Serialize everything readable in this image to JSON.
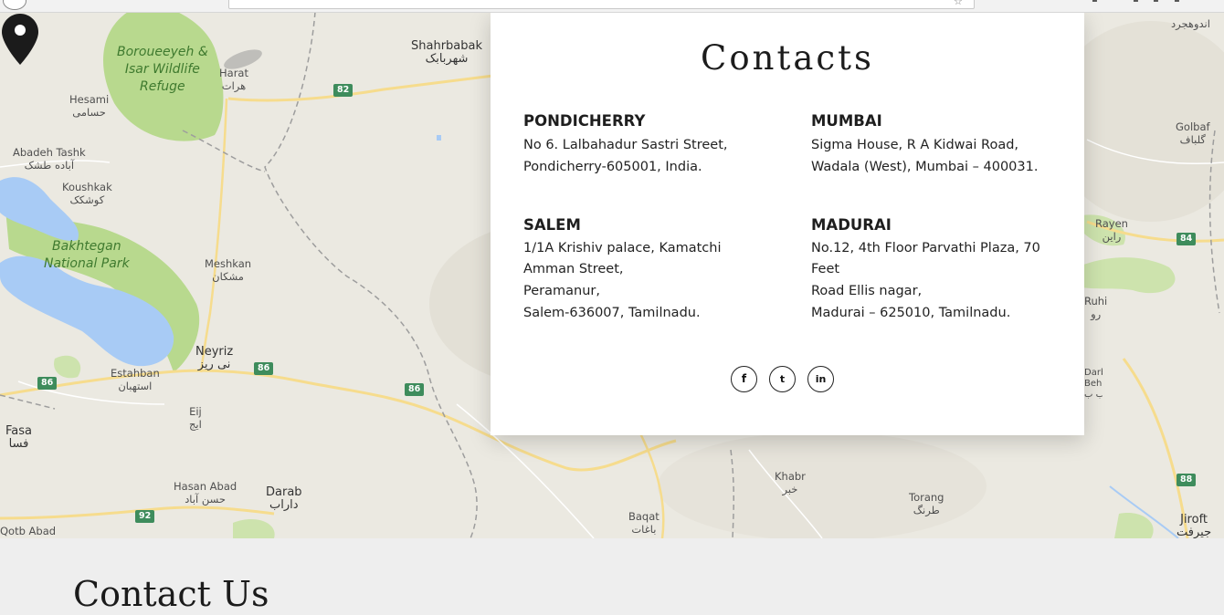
{
  "colors": {
    "map_bg": "#ebe9e1",
    "park": "#b8d98e",
    "water": "#a8cbf5",
    "road": "#f6dc8d",
    "shield": "#3e8c5c",
    "card_bg": "#ffffff",
    "heading": "#1c1c1c"
  },
  "map": {
    "labels": [
      {
        "id": "shahrbabak",
        "text": "Shahrbabak",
        "sub": "شهربابک"
      },
      {
        "id": "harat",
        "text": "Harat",
        "sub": "هرات"
      },
      {
        "id": "hesami",
        "text": "Hesami",
        "sub": "حسامی"
      },
      {
        "id": "abadeh-tashk",
        "text": "Abadeh Tashk",
        "sub": "آباده طشک"
      },
      {
        "id": "koushkak",
        "text": "Koushkak",
        "sub": "کوشکک"
      },
      {
        "id": "meshkan",
        "text": "Meshkan",
        "sub": "مشکان"
      },
      {
        "id": "neyriz",
        "text": "Neyriz",
        "sub": "نی ریز"
      },
      {
        "id": "estahban",
        "text": "Estahban",
        "sub": "استهبان"
      },
      {
        "id": "eij",
        "text": "Eij",
        "sub": "ایج"
      },
      {
        "id": "fasa",
        "text": "Fasa",
        "sub": "فسا"
      },
      {
        "id": "hasan-abad",
        "text": "Hasan Abad",
        "sub": "حسن آباد"
      },
      {
        "id": "darab",
        "text": "Darab",
        "sub": "داراب"
      },
      {
        "id": "baqat",
        "text": "Baqat",
        "sub": "باغات"
      },
      {
        "id": "khabr",
        "text": "Khabr",
        "sub": "خبر"
      },
      {
        "id": "torang",
        "text": "Torang",
        "sub": "طرنگ"
      },
      {
        "id": "jiroft",
        "text": "Jiroft",
        "sub": "جیرفت"
      },
      {
        "id": "golbaf",
        "text": "Golbaf",
        "sub": "گلباف"
      },
      {
        "id": "rayen",
        "text": "Rayen",
        "sub": "راین"
      },
      {
        "id": "ruhi",
        "text": "Ruhi",
        "sub": "رو"
      },
      {
        "id": "darb-e-behesht",
        "text": "Darb-e\nBehesht",
        "sub": "درب ب"
      },
      {
        "id": "andouhjerd",
        "text": "اندوهجرد",
        "sub": ""
      },
      {
        "id": "qotb-abad",
        "text": "Qotb Abad",
        "sub": ""
      }
    ],
    "parks": [
      {
        "id": "boroueeyeh",
        "text": "Boroueeyeh &\nIsar Wildlife\nRefuge"
      },
      {
        "id": "bakhtegan",
        "text": "Bakhtegan\nNational Park"
      }
    ],
    "shields": [
      "82",
      "86",
      "86",
      "86",
      "92",
      "84",
      "88"
    ],
    "marker_icon": "map-pin-icon"
  },
  "contacts": {
    "title": "Contacts",
    "offices": [
      {
        "city": "PONDICHERRY",
        "lines": [
          "No 6. Lalbahadur Sastri Street,",
          "Pondicherry-605001, India."
        ]
      },
      {
        "city": "MUMBAI",
        "lines": [
          "Sigma House, R A Kidwai Road,",
          "Wadala (West), Mumbai – 400031."
        ]
      },
      {
        "city": "SALEM",
        "lines": [
          "1/1A Krishiv palace, Kamatchi Amman Street,",
          "Peramanur,",
          "Salem-636007, Tamilnadu."
        ]
      },
      {
        "city": "MADURAI",
        "lines": [
          "No.12, 4th Floor Parvathi Plaza, 70 Feet",
          "Road Ellis nagar,",
          "Madurai – 625010, Tamilnadu."
        ]
      }
    ],
    "social": [
      {
        "name": "facebook",
        "glyph": "f"
      },
      {
        "name": "twitter",
        "glyph": "t"
      },
      {
        "name": "linkedin",
        "glyph": "in"
      }
    ]
  },
  "contact_us": {
    "title": "Contact Us"
  }
}
